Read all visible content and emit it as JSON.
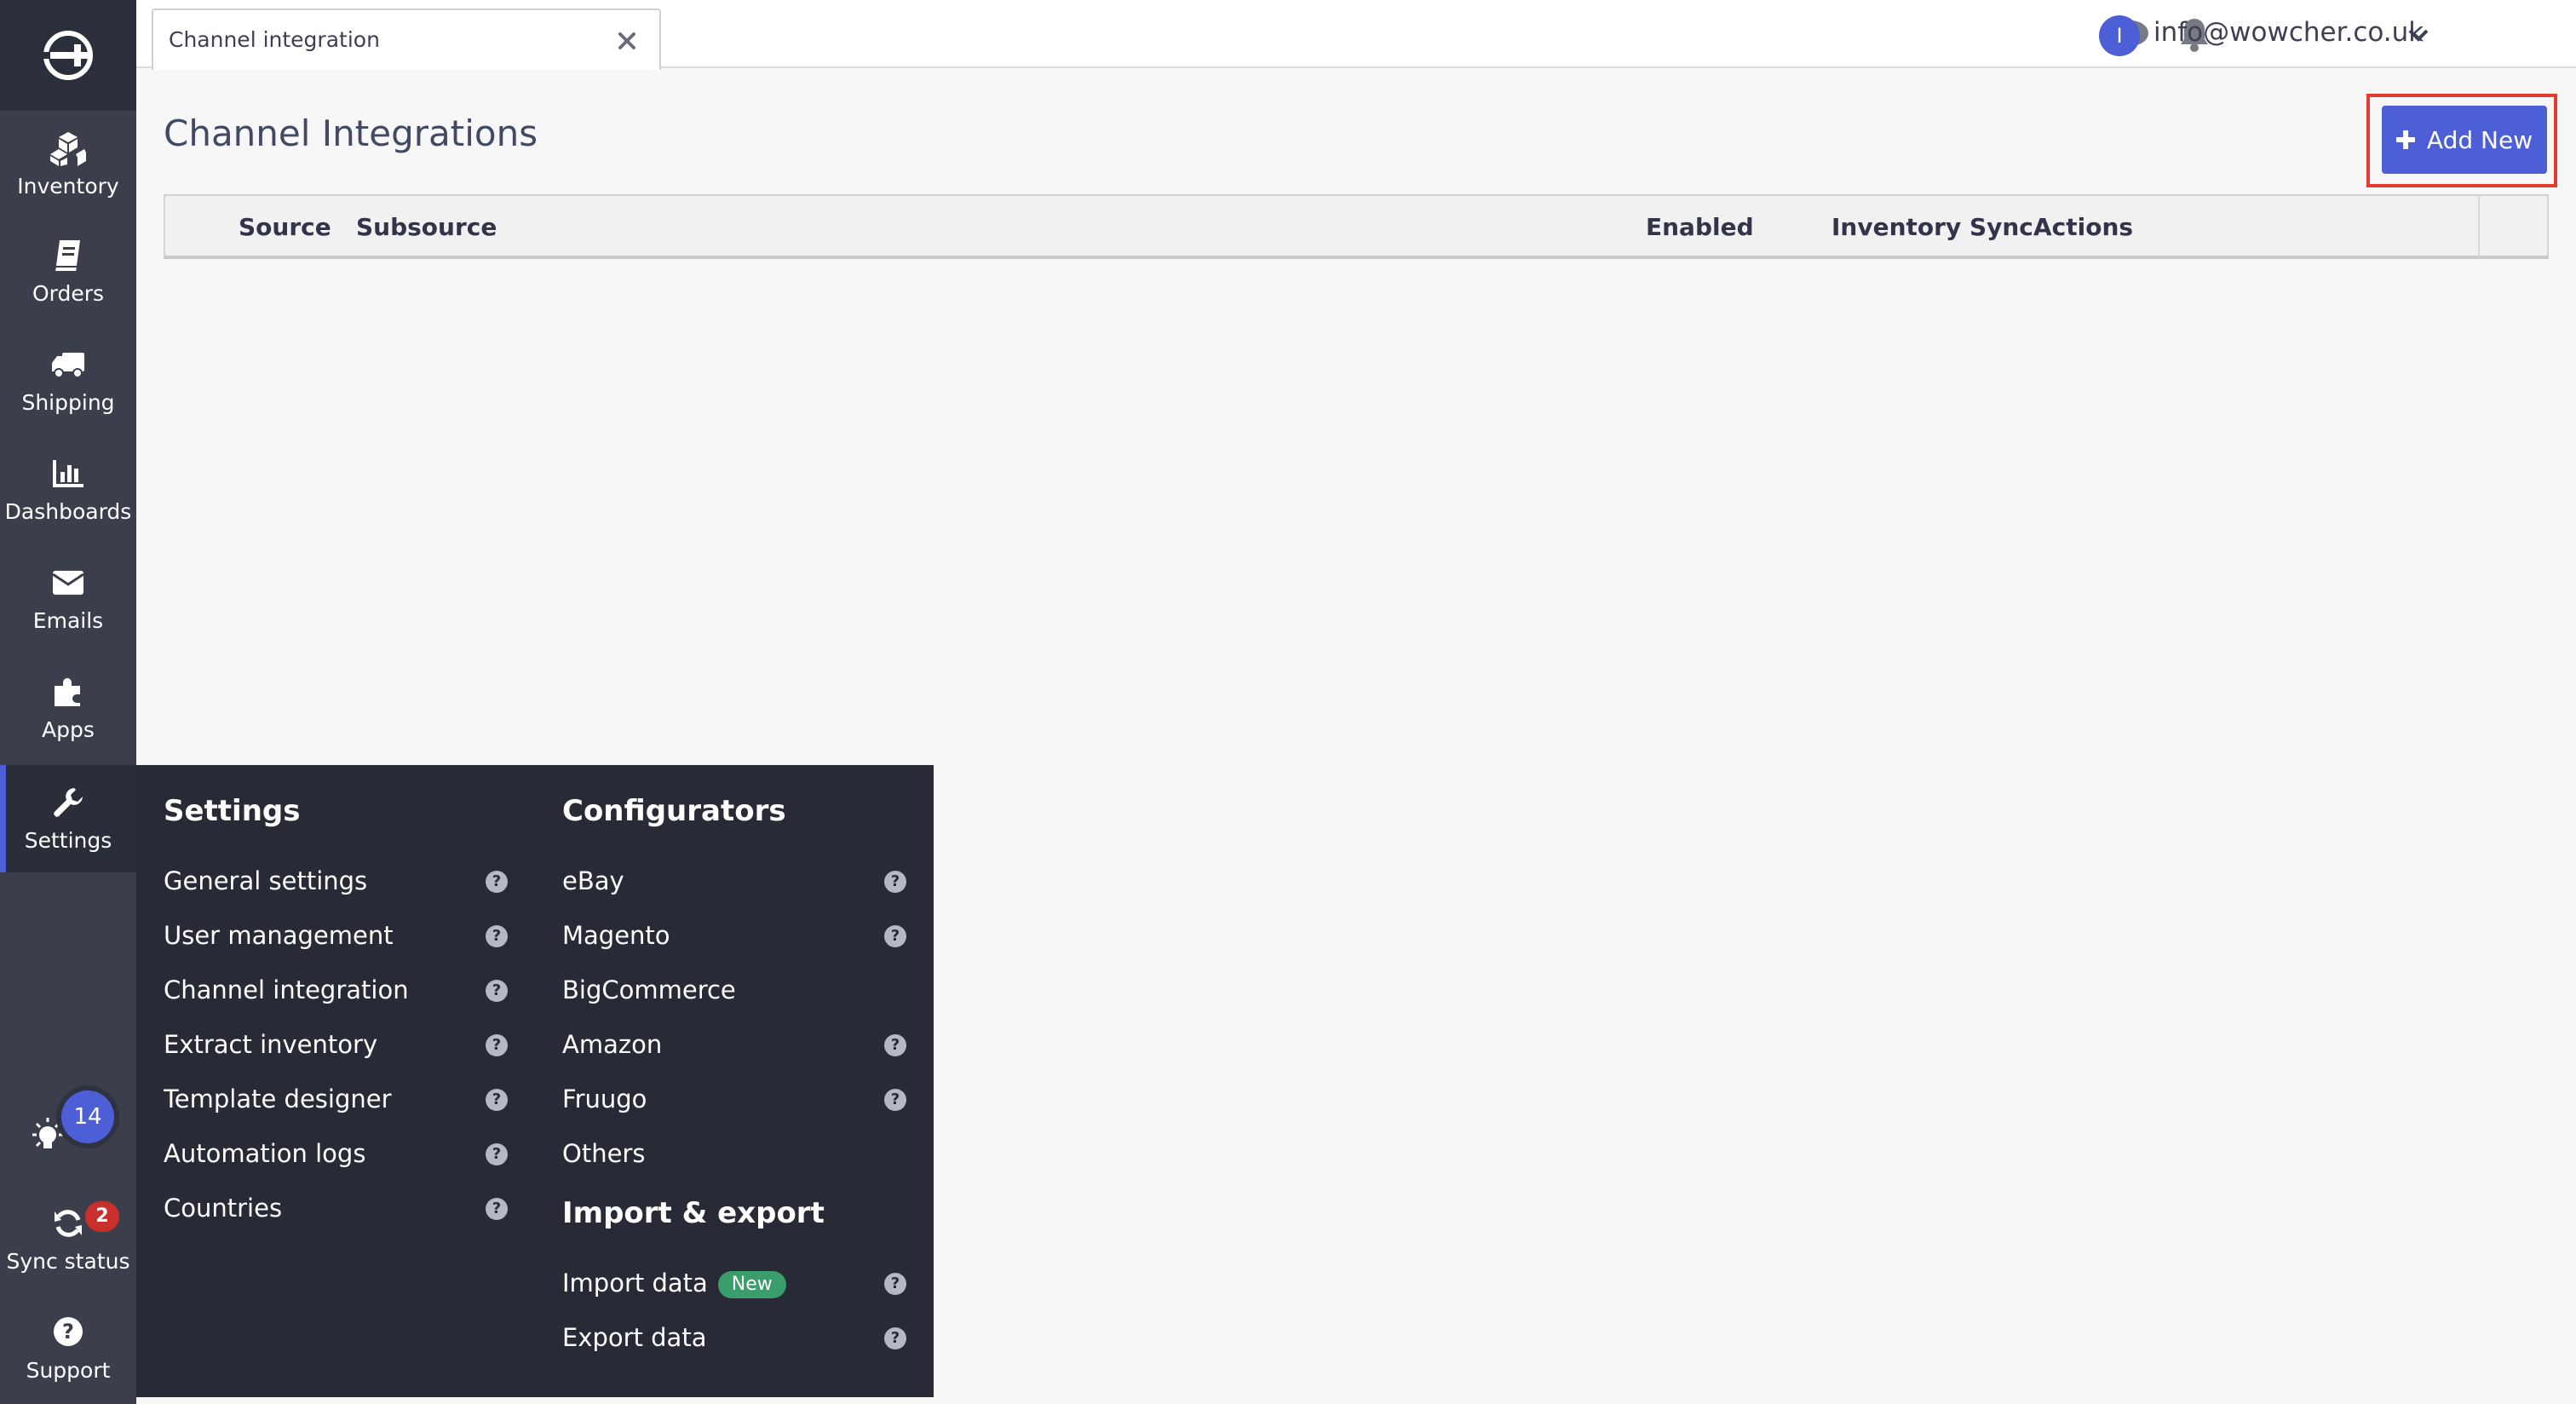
{
  "sidebar": {
    "items": [
      {
        "label": "Inventory",
        "icon": "cubes-icon"
      },
      {
        "label": "Orders",
        "icon": "book-icon"
      },
      {
        "label": "Shipping",
        "icon": "truck-icon"
      },
      {
        "label": "Dashboards",
        "icon": "bar-chart-icon"
      },
      {
        "label": "Emails",
        "icon": "envelope-icon"
      },
      {
        "label": "Apps",
        "icon": "puzzle-icon"
      },
      {
        "label": "Settings",
        "icon": "wrench-icon"
      }
    ],
    "active": "Settings",
    "tips_count": "14",
    "sync_label": "Sync status",
    "sync_count": "2",
    "support_label": "Support"
  },
  "topbar": {
    "tab_label": "Channel integration",
    "user_initial": "I",
    "user_email": "info@wowcher.co.uk"
  },
  "main": {
    "title": "Channel Integrations",
    "add_button": "Add New",
    "columns": [
      "Source",
      "Subsource",
      "Enabled",
      "Inventory Sync",
      "Actions"
    ]
  },
  "menu": {
    "settings": {
      "heading": "Settings",
      "items": [
        "General settings",
        "User management",
        "Channel integration",
        "Extract inventory",
        "Template designer",
        "Automation logs",
        "Countries"
      ]
    },
    "configurators": {
      "heading": "Configurators",
      "items": [
        "eBay",
        "Magento",
        "BigCommerce",
        "Amazon",
        "Fruugo",
        "Others"
      ]
    },
    "import_export": {
      "heading": "Import & export",
      "items": [
        "Import data",
        "Export data"
      ],
      "new_badge": "New"
    },
    "help_glyph": "?"
  },
  "colors": {
    "accent": "#4d5fd7",
    "sidebar": "#3b3f4b",
    "menu_bg": "#282b35",
    "highlight": "#e53a2f",
    "new_badge": "#3a9d6c",
    "sync_badge": "#c9302c"
  }
}
